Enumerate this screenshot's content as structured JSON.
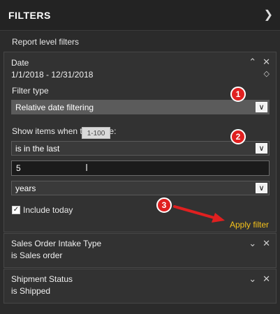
{
  "header": {
    "title": "FILTERS",
    "collapse_icon": "chevron-right-icon"
  },
  "section": {
    "label": "Report level filters"
  },
  "date_filter": {
    "title": "Date",
    "range": "1/1/2018 - 12/31/2018",
    "filter_type_label": "Filter type",
    "filter_type_value": "Relative date filtering",
    "show_items_label": "Show items when the value:",
    "condition_value": "is in the last",
    "amount_value": "5",
    "amount_tooltip": "1-100",
    "unit_value": "years",
    "include_today_label": "Include today",
    "include_today_checked": true,
    "apply_label": "Apply filter",
    "icons": [
      "chevron-up-icon",
      "close-icon",
      "eraser-icon"
    ]
  },
  "filters": [
    {
      "title": "Sales Order Intake Type",
      "value": "is Sales order"
    },
    {
      "title": "Shipment Status",
      "value": "is Shipped"
    }
  ],
  "annotations": {
    "badges": [
      "1",
      "2",
      "3"
    ],
    "color": "#e02020",
    "accent": "#f5c21b"
  }
}
